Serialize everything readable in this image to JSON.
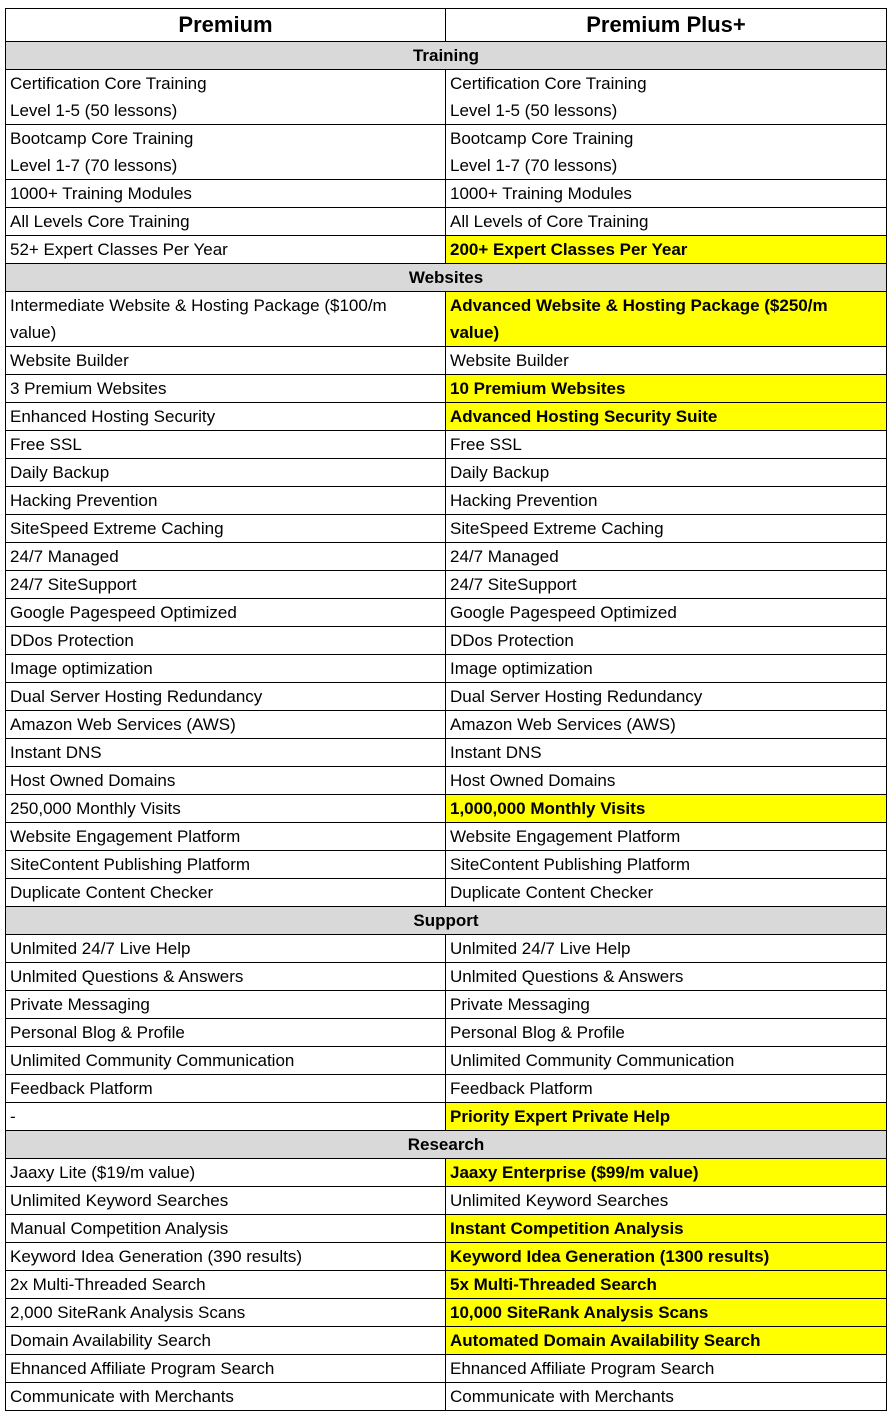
{
  "columns": [
    "Premium",
    "Premium Plus+"
  ],
  "colors": {
    "section_bg": "#d9d9d9",
    "highlight_bg": "#ffff00",
    "border": "#000000"
  },
  "sections": [
    {
      "title": "Training",
      "rows": [
        {
          "premium": [
            "Certification Core Training",
            "Level 1-5 (50 lessons)"
          ],
          "plus": [
            "Certification Core Training",
            "Level 1-5 (50 lessons)"
          ],
          "highlight": false
        },
        {
          "premium": [
            "Bootcamp Core Training",
            "Level 1-7 (70 lessons)"
          ],
          "plus": [
            "Bootcamp Core Training",
            "Level 1-7 (70 lessons)"
          ],
          "highlight": false
        },
        {
          "premium": [
            "1000+ Training Modules"
          ],
          "plus": [
            "1000+ Training Modules"
          ],
          "highlight": false
        },
        {
          "premium": [
            "All Levels Core Training"
          ],
          "plus": [
            "All Levels of Core Training"
          ],
          "highlight": false
        },
        {
          "premium": [
            "52+ Expert Classes Per Year"
          ],
          "plus": [
            "200+ Expert Classes Per Year"
          ],
          "highlight": true
        }
      ]
    },
    {
      "title": "Websites",
      "rows": [
        {
          "premium": [
            "Intermediate Website & Hosting Package ($100/m",
            "value)"
          ],
          "plus": [
            "Advanced Website & Hosting Package ($250/m",
            "value)"
          ],
          "highlight": true
        },
        {
          "premium": [
            "Website Builder"
          ],
          "plus": [
            "Website Builder"
          ],
          "highlight": false
        },
        {
          "premium": [
            "3 Premium Websites"
          ],
          "plus": [
            "10 Premium Websites"
          ],
          "highlight": true
        },
        {
          "premium": [
            "Enhanced Hosting Security"
          ],
          "plus": [
            "Advanced Hosting Security Suite"
          ],
          "highlight": true
        },
        {
          "premium": [
            "Free SSL"
          ],
          "plus": [
            "Free SSL"
          ],
          "highlight": false
        },
        {
          "premium": [
            "Daily Backup"
          ],
          "plus": [
            "Daily Backup"
          ],
          "highlight": false
        },
        {
          "premium": [
            "Hacking Prevention"
          ],
          "plus": [
            "Hacking Prevention"
          ],
          "highlight": false
        },
        {
          "premium": [
            "SiteSpeed Extreme Caching"
          ],
          "plus": [
            "SiteSpeed Extreme Caching"
          ],
          "highlight": false
        },
        {
          "premium": [
            "24/7 Managed"
          ],
          "plus": [
            "24/7 Managed"
          ],
          "highlight": false
        },
        {
          "premium": [
            "24/7 SiteSupport"
          ],
          "plus": [
            "24/7 SiteSupport"
          ],
          "highlight": false
        },
        {
          "premium": [
            "Google Pagespeed Optimized"
          ],
          "plus": [
            "Google Pagespeed Optimized"
          ],
          "highlight": false
        },
        {
          "premium": [
            "DDos Protection"
          ],
          "plus": [
            "DDos Protection"
          ],
          "highlight": false
        },
        {
          "premium": [
            "Image optimization"
          ],
          "plus": [
            "Image optimization"
          ],
          "highlight": false
        },
        {
          "premium": [
            "Dual Server Hosting Redundancy"
          ],
          "plus": [
            "Dual Server Hosting Redundancy"
          ],
          "highlight": false
        },
        {
          "premium": [
            "Amazon Web Services (AWS)"
          ],
          "plus": [
            "Amazon Web Services (AWS)"
          ],
          "highlight": false
        },
        {
          "premium": [
            "Instant DNS"
          ],
          "plus": [
            "Instant DNS"
          ],
          "highlight": false
        },
        {
          "premium": [
            "Host Owned Domains"
          ],
          "plus": [
            "Host Owned Domains"
          ],
          "highlight": false
        },
        {
          "premium": [
            "250,000 Monthly Visits"
          ],
          "plus": [
            "1,000,000 Monthly Visits"
          ],
          "highlight": true
        },
        {
          "premium": [
            "Website Engagement Platform"
          ],
          "plus": [
            "Website Engagement Platform"
          ],
          "highlight": false
        },
        {
          "premium": [
            "SiteContent Publishing Platform"
          ],
          "plus": [
            "SiteContent Publishing Platform"
          ],
          "highlight": false
        },
        {
          "premium": [
            "Duplicate Content Checker"
          ],
          "plus": [
            "Duplicate Content Checker"
          ],
          "highlight": false
        }
      ]
    },
    {
      "title": "Support",
      "rows": [
        {
          "premium": [
            "Unlmited 24/7 Live Help"
          ],
          "plus": [
            "Unlmited 24/7 Live Help"
          ],
          "highlight": false
        },
        {
          "premium": [
            "Unlmited Questions & Answers"
          ],
          "plus": [
            "Unlmited Questions & Answers"
          ],
          "highlight": false
        },
        {
          "premium": [
            "Private Messaging"
          ],
          "plus": [
            "Private Messaging"
          ],
          "highlight": false
        },
        {
          "premium": [
            "Personal Blog & Profile"
          ],
          "plus": [
            "Personal Blog & Profile"
          ],
          "highlight": false
        },
        {
          "premium": [
            "Unlimited Community Communication"
          ],
          "plus": [
            "Unlimited Community Communication"
          ],
          "highlight": false
        },
        {
          "premium": [
            "Feedback Platform"
          ],
          "plus": [
            "Feedback Platform"
          ],
          "highlight": false
        },
        {
          "premium": [
            "-"
          ],
          "plus": [
            "Priority Expert Private Help"
          ],
          "highlight": true
        }
      ]
    },
    {
      "title": "Research",
      "rows": [
        {
          "premium": [
            "Jaaxy Lite ($19/m value)"
          ],
          "plus": [
            "Jaaxy Enterprise ($99/m value)"
          ],
          "highlight": true
        },
        {
          "premium": [
            "Unlimited Keyword Searches"
          ],
          "plus": [
            "Unlimited Keyword Searches"
          ],
          "highlight": false
        },
        {
          "premium": [
            "Manual Competition Analysis"
          ],
          "plus": [
            "Instant Competition Analysis"
          ],
          "highlight": true
        },
        {
          "premium": [
            "Keyword Idea Generation (390 results)"
          ],
          "plus": [
            "Keyword Idea Generation (1300 results)"
          ],
          "highlight": true
        },
        {
          "premium": [
            "2x Multi-Threaded Search"
          ],
          "plus": [
            "5x Multi-Threaded Search"
          ],
          "highlight": true
        },
        {
          "premium": [
            "2,000 SiteRank Analysis Scans"
          ],
          "plus": [
            "10,000 SiteRank Analysis Scans"
          ],
          "highlight": true
        },
        {
          "premium": [
            "Domain Availability Search"
          ],
          "plus": [
            "Automated Domain Availability Search"
          ],
          "highlight": true
        },
        {
          "premium": [
            "Ehnanced Affiliate Program Search"
          ],
          "plus": [
            "Ehnanced Affiliate Program Search"
          ],
          "highlight": false
        },
        {
          "premium": [
            "Communicate with Merchants"
          ],
          "plus": [
            "Communicate with Merchants"
          ],
          "highlight": false
        }
      ]
    }
  ]
}
